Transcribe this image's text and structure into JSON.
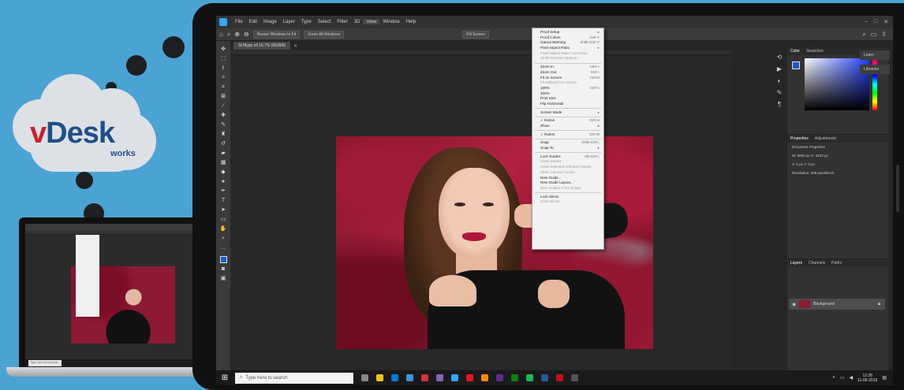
{
  "brand": {
    "v": "v",
    "name": "Desk",
    "sub": "works"
  },
  "menubar": [
    "File",
    "Edit",
    "Image",
    "Layer",
    "Type",
    "Select",
    "Filter",
    "3D",
    "View",
    "Window",
    "Help"
  ],
  "options_bar": {
    "buttons": [
      "Resize Windows to Fit",
      "Zoom All Windows",
      "Fill Screen"
    ]
  },
  "document_tab": {
    "title": "St Mypp ell 16.7% (RGB/8)"
  },
  "view_menu": [
    {
      "label": "Proof Setup",
      "shortcut": "▸"
    },
    {
      "label": "Proof Colors",
      "shortcut": "Ctrl+Y"
    },
    {
      "label": "Gamut Warning",
      "shortcut": "Shift+Ctrl+Y"
    },
    {
      "label": "Pixel Aspect Ratio",
      "shortcut": "▸"
    },
    {
      "label": "Pixel Aspect Ratio Correction",
      "shortcut": "",
      "disabled": true
    },
    {
      "label": "32-bit Preview Options...",
      "shortcut": "",
      "disabled": true
    },
    {
      "sep": true
    },
    {
      "label": "Zoom In",
      "shortcut": "Ctrl++"
    },
    {
      "label": "Zoom Out",
      "shortcut": "Ctrl+-"
    },
    {
      "label": "Fit on Screen",
      "shortcut": "Ctrl+0"
    },
    {
      "label": "Fit Artboard on Screen",
      "shortcut": "",
      "disabled": true
    },
    {
      "label": "100%",
      "shortcut": "Ctrl+1"
    },
    {
      "label": "200%",
      "shortcut": ""
    },
    {
      "label": "Print Size",
      "shortcut": ""
    },
    {
      "label": "Flip Horizontal",
      "shortcut": ""
    },
    {
      "sep": true
    },
    {
      "label": "Screen Mode",
      "shortcut": "▸"
    },
    {
      "sep": true
    },
    {
      "label": "✓ Extras",
      "shortcut": "Ctrl+H"
    },
    {
      "label": "Show",
      "shortcut": "▸"
    },
    {
      "sep": true
    },
    {
      "label": "✓ Rulers",
      "shortcut": "Ctrl+R"
    },
    {
      "sep": true
    },
    {
      "label": "Snap",
      "shortcut": "Shift+Ctrl+;"
    },
    {
      "label": "Snap To",
      "shortcut": "▸"
    },
    {
      "sep": true
    },
    {
      "label": "Lock Guides",
      "shortcut": "Alt+Ctrl+;"
    },
    {
      "label": "Clear Guides",
      "shortcut": "",
      "disabled": true
    },
    {
      "label": "Clear Selected Artboard Guides",
      "shortcut": "",
      "disabled": true
    },
    {
      "label": "Clear Canvas Guides",
      "shortcut": "",
      "disabled": true
    },
    {
      "label": "New Guide...",
      "shortcut": ""
    },
    {
      "label": "New Guide Layout...",
      "shortcut": ""
    },
    {
      "label": "New Guides From Shape",
      "shortcut": "",
      "disabled": true
    },
    {
      "sep": true
    },
    {
      "label": "Lock Slices",
      "shortcut": ""
    },
    {
      "label": "Clear Slices",
      "shortcut": "",
      "disabled": true
    }
  ],
  "panels": {
    "color_tabs": [
      "Color",
      "Swatches"
    ],
    "props_tabs": [
      "Properties",
      "Adjustments"
    ],
    "props_title": "Document Properties",
    "props_rows": [
      "W: 5000 px    H: 3333 px",
      "X: 0 px    Y: 0 px",
      "Resolution: 300 pixels/inch"
    ],
    "layers_tabs": [
      "Layers",
      "Channels",
      "Paths"
    ],
    "layer_name": "Background",
    "learn": [
      "Learn",
      "Libraries"
    ]
  },
  "taskbar": {
    "search_placeholder": "Type here to search",
    "time": "12:28",
    "date": "11-06-2019"
  },
  "colors": {
    "accent": "#31a8ff",
    "bg": "#4ba3d3"
  }
}
